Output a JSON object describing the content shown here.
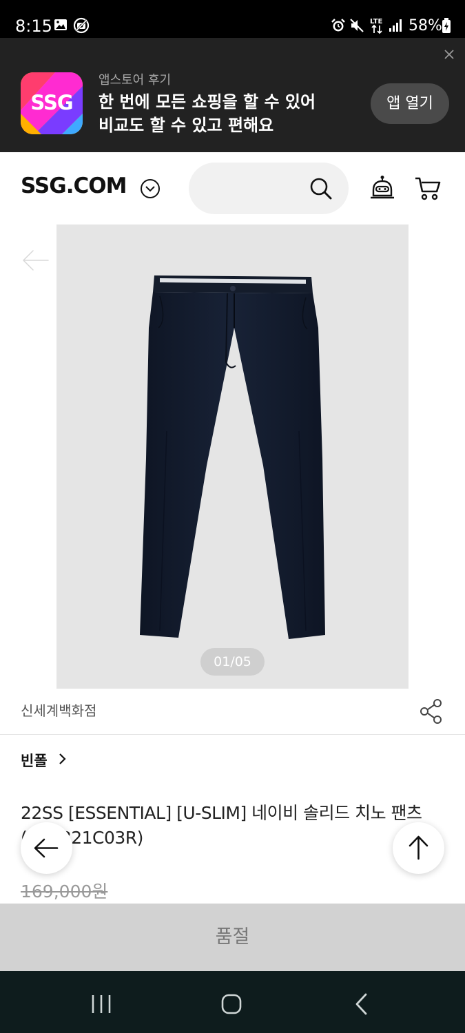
{
  "status_bar": {
    "time": "8:15",
    "battery": "58%",
    "network": "LTE",
    "icons": [
      "gallery-icon",
      "no-camera-icon",
      "alarm-icon",
      "mute-icon",
      "lte-icon",
      "signal-icon",
      "battery-icon"
    ]
  },
  "app_banner": {
    "logo_text": "SSG",
    "subtitle": "앱스토어 후기",
    "headline_line1": "한 번에 모든 쇼핑을 할 수 있어",
    "headline_line2": "비교도 할 수 있고 편해요",
    "open_button": "앱 열기"
  },
  "header": {
    "brand": "SSG.COM",
    "search_placeholder": ""
  },
  "gallery": {
    "counter": "01/05"
  },
  "store_name": "신세계백화점",
  "brand_link": "빈폴",
  "product": {
    "title": "22SS [ESSENTIAL] [U-SLIM] 네이비 솔리드 치노 팬츠(BC2321C03R)",
    "price": "169,000원"
  },
  "status_button": "품절",
  "colors": {
    "banner_bg": "#222222",
    "soldout_bg": "#d2d2d2",
    "navbar_bg": "#0e1c1d",
    "pants": "#141c2b"
  }
}
